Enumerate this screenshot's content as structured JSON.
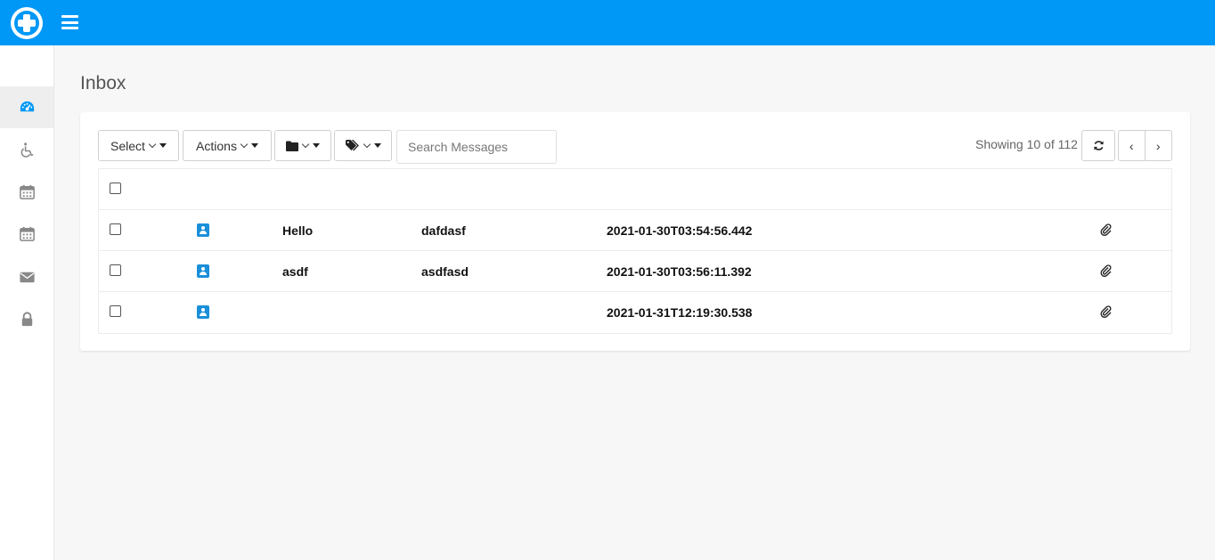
{
  "sidebar": {
    "items": [
      {
        "icon": "dashboard-icon",
        "active": true
      },
      {
        "icon": "wheelchair-icon",
        "active": false
      },
      {
        "icon": "calendar-icon",
        "active": false
      },
      {
        "icon": "calendar-icon",
        "active": false
      },
      {
        "icon": "envelope-icon",
        "active": false
      },
      {
        "icon": "lock-icon",
        "active": false
      }
    ]
  },
  "page": {
    "title": "Inbox"
  },
  "toolbar": {
    "select_label": "Select",
    "actions_label": "Actions",
    "folder_icon": "folder-icon",
    "tag_icon": "tag-icon",
    "search_placeholder": "Search Messages",
    "showing": "Showing 10 of 112",
    "prev": "‹",
    "next": "›"
  },
  "messages": [
    {
      "sender": "Hello",
      "subject": "dafdasf",
      "date": "2021-01-30T03:54:56.442",
      "attachment": true
    },
    {
      "sender": "asdf",
      "subject": "asdfasd",
      "date": "2021-01-30T03:56:11.392",
      "attachment": true
    },
    {
      "sender": "",
      "subject": "",
      "date": "2021-01-31T12:19:30.538",
      "attachment": true
    }
  ],
  "colors": {
    "brand": "#0098f7",
    "icon_blue": "#1a8fd9",
    "sidebar_icon": "#888888"
  }
}
